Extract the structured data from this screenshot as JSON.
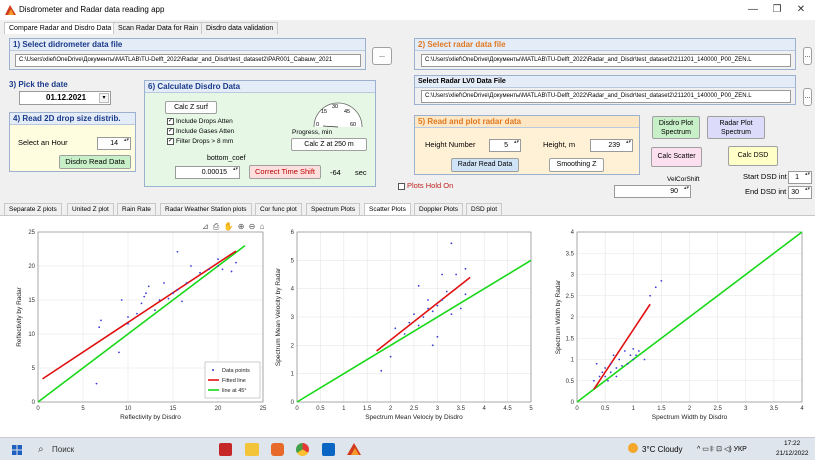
{
  "window": {
    "title": "Disdrometer and Radar data reading app",
    "minimize": "—",
    "maximize": "❐",
    "close": "✕"
  },
  "top_tabs": [
    "Compare Radar and Disdro Data",
    "Scan Radar Data for Rain",
    "Disdro data validation"
  ],
  "panel1": {
    "title": "1) Select didrometer data file",
    "path": "C:\\Users\\xlief\\OneDrive\\Документы\\MATLAB\\TU-Delft_2022\\Radar_and_Disdr\\test_dataset2\\PAR001_Cabauw_2021",
    "browse": "..."
  },
  "panel2": {
    "title": "2) Select radar data file",
    "path": "C:\\Users\\xlief\\OneDrive\\Документы\\MATLAB\\TU-Delft_2022\\Radar_and_Disdr\\test_dataset2\\211201_140000_P00_ZEN.L",
    "browse": "..."
  },
  "panel_lv0": {
    "title": "Select Radar LV0 Data File",
    "path": "C:\\Users\\xlief\\OneDrive\\Документы\\MATLAB\\TU-Delft_2022\\Radar_and_Disdr\\test_dataset2\\211201_140000_P00_ZEN.L",
    "browse": "..."
  },
  "panel3": {
    "title": "3) Pick the date",
    "date": "01.12.2021"
  },
  "panel4": {
    "title": "4) Read 2D drop size distrib.",
    "hour_label": "Select an Hour",
    "hour_value": "14",
    "read_button": "Disdro Read Data"
  },
  "panel6": {
    "title": "6) Calculate Disdro Data",
    "calc_z_surf": "Calc Z surf",
    "checkboxes": [
      {
        "label": "Include Drops Atten",
        "checked": true
      },
      {
        "label": "Include Gases Atten",
        "checked": true
      },
      {
        "label": "Filter Drops > 8 mm",
        "checked": true
      }
    ],
    "gauge_ticks": [
      "0",
      "15",
      "30",
      "45",
      "60"
    ],
    "gauge_label": "Progress, min",
    "calc_z_250": "Calc Z at 250 m",
    "bottom_coef_label": "bottom_coef",
    "bottom_coef_value": "0.00015",
    "correct_time_shift": "Correct Time Shift",
    "shift_value": "-64",
    "shift_unit": "sec"
  },
  "panel5": {
    "title": "5) Read and plot radar data",
    "height_number_label": "Height Number",
    "height_number_value": "5",
    "height_m_label": "Height, m",
    "height_m_value": "239",
    "radar_read": "Radar Read Data",
    "smoothing": "Smoothing Z"
  },
  "right_buttons": {
    "disdro_plot": "Disdro Plot Spectrum",
    "radar_plot": "Radar Plot Spectrum",
    "calc_scatter": "Calc Scatter",
    "calc_dsd": "Calc DSD",
    "start_dsd_label": "Start DSD int",
    "start_dsd_value": "1",
    "end_dsd_label": "End DSD int",
    "end_dsd_value": "30",
    "velcorshift_label": "VelCorShift",
    "velcorshift_value": "90"
  },
  "plots_hold_on": "Plots Hold On",
  "plot_tabs": [
    "Separate Z plots",
    "United Z plot",
    "Rain Rate",
    "Radar Weather Station plots",
    "Cor func plot",
    "Spectrum Plots",
    "Scatter Plots",
    "Doppler Plots",
    "DSD plot"
  ],
  "active_plot_tab": "Scatter Plots",
  "axes_toolbar": "⊿ ⎙ ✋ ⊕ ⊖ ⌂",
  "colors": {
    "points": "#3b3bd6",
    "fit": "#e01010",
    "line45": "#18d818",
    "accent": "#1a3a8a",
    "orange_title": "#e07820"
  },
  "chart_data": [
    {
      "type": "scatter",
      "xlabel": "Reflectivity by Disdro",
      "ylabel": "Reflectivity by Radar",
      "xlim": [
        0,
        25
      ],
      "ylim": [
        0,
        25
      ],
      "xticks": [
        "0",
        "5",
        "10",
        "15",
        "20",
        "25"
      ],
      "yticks": [
        "0",
        "5",
        "10",
        "15",
        "20",
        "25"
      ],
      "points": [
        [
          6.5,
          2.7
        ],
        [
          6.8,
          11
        ],
        [
          7,
          12
        ],
        [
          9,
          7.3
        ],
        [
          9.3,
          15
        ],
        [
          10,
          11.5
        ],
        [
          10,
          12.5
        ],
        [
          11,
          13
        ],
        [
          11.5,
          14.5
        ],
        [
          11.8,
          15.5
        ],
        [
          12,
          16
        ],
        [
          12.3,
          17
        ],
        [
          13,
          13.5
        ],
        [
          13.5,
          15
        ],
        [
          14,
          17.5
        ],
        [
          14.5,
          15.2
        ],
        [
          15,
          16
        ],
        [
          15.5,
          16.5
        ],
        [
          15.5,
          22.1
        ],
        [
          16,
          14.8
        ],
        [
          16.5,
          17.5
        ],
        [
          17,
          20
        ],
        [
          18,
          19
        ],
        [
          19,
          19.5
        ],
        [
          20,
          20
        ],
        [
          20,
          21
        ],
        [
          20.5,
          19.5
        ],
        [
          21.5,
          19.2
        ],
        [
          22,
          20.5
        ]
      ],
      "fit": [
        [
          0.5,
          3.4
        ],
        [
          22,
          22.2
        ]
      ],
      "line45": [
        [
          0,
          0
        ],
        [
          23,
          23
        ]
      ],
      "legend": [
        "Data points",
        "Fitted line",
        "line  at  45°"
      ]
    },
    {
      "type": "scatter",
      "xlabel": "Spectrum Mean Velociy by Disdro",
      "ylabel": "Spectrum Mean Velocity by Radar",
      "xlim": [
        0,
        5
      ],
      "ylim": [
        0,
        6
      ],
      "xticks": [
        "0",
        "0.5",
        "1",
        "1.5",
        "2",
        "2.5",
        "3",
        "3.5",
        "4",
        "4.5",
        "5"
      ],
      "yticks": [
        "0",
        "1",
        "2",
        "3",
        "4",
        "5",
        "6"
      ],
      "points": [
        [
          1.8,
          1.1
        ],
        [
          2,
          1.6
        ],
        [
          2.1,
          2.6
        ],
        [
          2.3,
          2.4
        ],
        [
          2.4,
          2.8
        ],
        [
          2.5,
          3.1
        ],
        [
          2.6,
          2.7
        ],
        [
          2.6,
          4.1
        ],
        [
          2.7,
          3
        ],
        [
          2.8,
          3.3
        ],
        [
          2.8,
          3.6
        ],
        [
          2.9,
          3.2
        ],
        [
          2.9,
          2
        ],
        [
          3,
          3.4
        ],
        [
          3,
          2.3
        ],
        [
          3.1,
          3.6
        ],
        [
          3.1,
          4.5
        ],
        [
          3.2,
          3.9
        ],
        [
          3.3,
          5.6
        ],
        [
          3.3,
          3.1
        ],
        [
          3.4,
          4.5
        ],
        [
          3.5,
          3.3
        ],
        [
          3.6,
          4.7
        ],
        [
          3.6,
          3.8
        ]
      ],
      "fit": [
        [
          1.7,
          1.8
        ],
        [
          3.7,
          4.4
        ]
      ],
      "line45": [
        [
          0,
          0
        ],
        [
          5,
          5
        ]
      ]
    },
    {
      "type": "scatter",
      "xlabel": "Spectrum Width by Disdro",
      "ylabel": "Spectrum Width by Radar",
      "xlim": [
        0,
        4
      ],
      "ylim": [
        0,
        4
      ],
      "xticks": [
        "0",
        "0.5",
        "1",
        "1.5",
        "2",
        "2.5",
        "3",
        "3.5",
        "4"
      ],
      "yticks": [
        "0",
        "0.5",
        "1",
        "1.5",
        "2",
        "2.5",
        "3",
        "3.5",
        "4"
      ],
      "points": [
        [
          0.3,
          0.5
        ],
        [
          0.35,
          0.9
        ],
        [
          0.4,
          0.6
        ],
        [
          0.45,
          0.7
        ],
        [
          0.5,
          0.6
        ],
        [
          0.5,
          0.8
        ],
        [
          0.55,
          0.5
        ],
        [
          0.6,
          0.9
        ],
        [
          0.6,
          0.7
        ],
        [
          0.65,
          1.1
        ],
        [
          0.7,
          0.8
        ],
        [
          0.7,
          0.6
        ],
        [
          0.75,
          1
        ],
        [
          0.8,
          0.85
        ],
        [
          0.85,
          1.2
        ],
        [
          0.9,
          0.9
        ],
        [
          0.95,
          1.1
        ],
        [
          1,
          1
        ],
        [
          1,
          1.25
        ],
        [
          1.05,
          1.1
        ],
        [
          1.1,
          1.2
        ],
        [
          1.2,
          1
        ],
        [
          1.3,
          2.5
        ],
        [
          1.4,
          2.7
        ],
        [
          1.5,
          2.85
        ]
      ],
      "fit": [
        [
          0.3,
          0.3
        ],
        [
          1.3,
          2.3
        ]
      ],
      "line45": [
        [
          0,
          0
        ],
        [
          4,
          4
        ]
      ]
    }
  ],
  "taskbar": {
    "search": "Поиск",
    "weather": "3°C Cloudy",
    "tray": "^ ▭ 𝄆 ⊡ ◁) УКР",
    "time": "17:22",
    "date": "21/12/2022"
  }
}
